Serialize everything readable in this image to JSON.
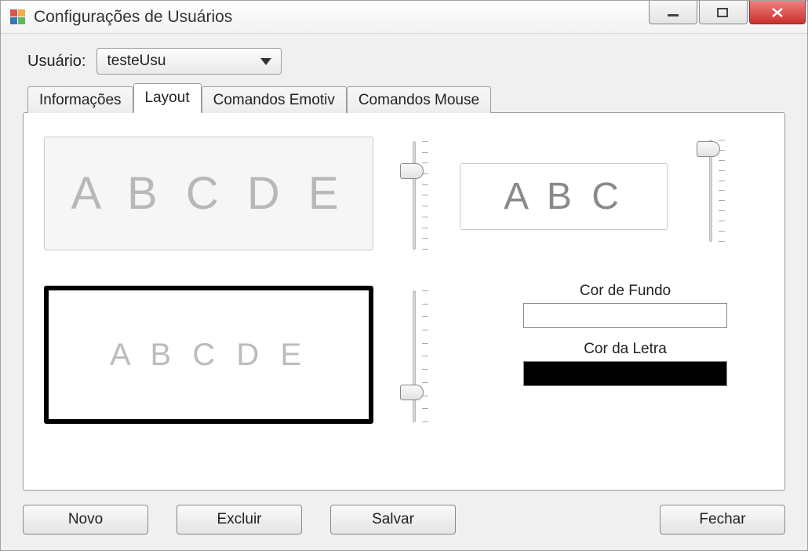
{
  "window": {
    "title": "Configurações de Usuários"
  },
  "user": {
    "label": "Usuário:",
    "selected": "testeUsu"
  },
  "tabs": [
    {
      "label": "Informações"
    },
    {
      "label": "Layout"
    },
    {
      "label": "Comandos Emotiv"
    },
    {
      "label": "Comandos Mouse"
    }
  ],
  "active_tab_index": 1,
  "layout_panel": {
    "preview1_text": "A B C D E",
    "preview2_text": "A B C",
    "preview3_text": "A B C D E",
    "bg_color_label": "Cor de Fundo",
    "fg_color_label": "Cor da Letra",
    "bg_color": "#ffffff",
    "fg_color": "#000000"
  },
  "buttons": {
    "novo": "Novo",
    "excluir": "Excluir",
    "salvar": "Salvar",
    "fechar": "Fechar"
  }
}
